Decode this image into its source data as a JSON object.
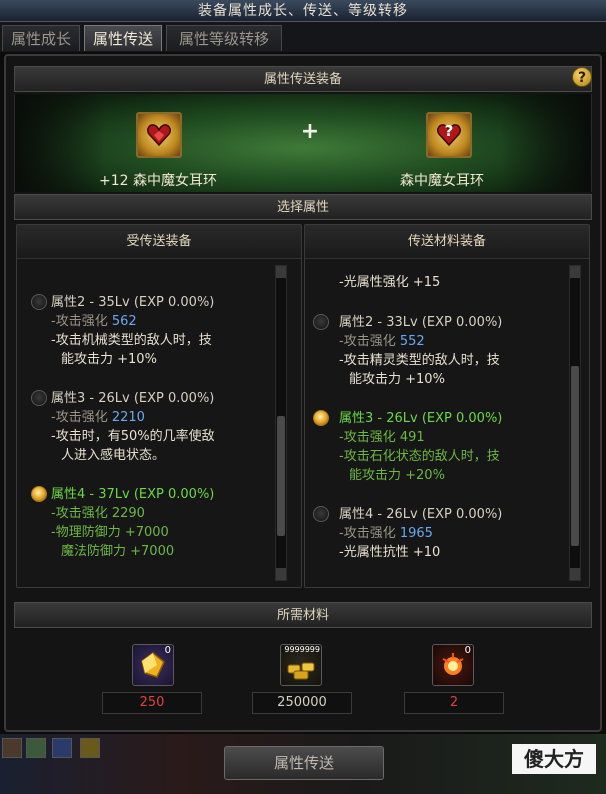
{
  "window": {
    "title": "装备属性成长、传送、等级转移"
  },
  "tabs": [
    {
      "label": "属性成长",
      "active": false
    },
    {
      "label": "属性传送",
      "active": true
    },
    {
      "label": "属性等级转移",
      "active": false
    }
  ],
  "transfer_equipment": {
    "header": "属性传送装备",
    "help_icon": "?",
    "source_item": {
      "name": "+12 森中魔女耳环",
      "icon": "heart-earring-icon"
    },
    "plus": "+",
    "target_item": {
      "name": "森中魔女耳环",
      "icon": "heart-earring-unknown-icon",
      "badge": "?"
    }
  },
  "select_attributes": {
    "header": "选择属性",
    "receiver": {
      "header": "受传送装备",
      "entries": [
        {
          "selected": false,
          "title": "属性2 - 35Lv (EXP 0.00%)",
          "sub_label": "-攻击强化",
          "sub_value": "562",
          "lines": [
            "-攻击机械类型的敌人时，技",
            "能攻击力 +10%"
          ]
        },
        {
          "selected": false,
          "title": "属性3 - 26Lv (EXP 0.00%)",
          "sub_label": "-攻击强化",
          "sub_value": "2210",
          "lines": [
            "-攻击时，有50%的几率使敌",
            "人进入感电状态。"
          ]
        },
        {
          "selected": true,
          "title": "属性4 - 37Lv (EXP 0.00%)",
          "sub_label": "-攻击强化",
          "sub_value": "2290",
          "lines": [
            "-物理防御力 +7000",
            "魔法防御力 +7000"
          ]
        }
      ]
    },
    "material": {
      "header": "传送材料装备",
      "top_line": "-光属性强化 +15",
      "entries": [
        {
          "selected": false,
          "title": "属性2 - 33Lv (EXP 0.00%)",
          "sub_label": "-攻击强化",
          "sub_value": "552",
          "lines": [
            "-攻击精灵类型的敌人时，技",
            "能攻击力 +10%"
          ]
        },
        {
          "selected": true,
          "title": "属性3 - 26Lv (EXP 0.00%)",
          "sub_label": "-攻击强化",
          "sub_value": "491",
          "lines": [
            "-攻击石化状态的敌人时，技",
            "能攻击力 +20%"
          ]
        },
        {
          "selected": false,
          "title": "属性4 - 26Lv (EXP 0.00%)",
          "sub_label": "-攻击强化",
          "sub_value": "1965",
          "lines": [
            "-光属性抗性 +10"
          ]
        }
      ]
    }
  },
  "required_materials": {
    "header": "所需材料",
    "items": [
      {
        "icon": "gold-crystal-icon",
        "count_badge": "0",
        "value": "250",
        "value_color": "#e04040"
      },
      {
        "icon": "gold-coins-icon",
        "count_badge": "9999999",
        "value": "250000",
        "value_color": "#d8d0c0"
      },
      {
        "icon": "fire-orb-icon",
        "count_badge": "0",
        "value": "2",
        "value_color": "#e04040"
      }
    ]
  },
  "action_button": {
    "label": "属性传送"
  },
  "watermark": {
    "text": "傻大方"
  }
}
